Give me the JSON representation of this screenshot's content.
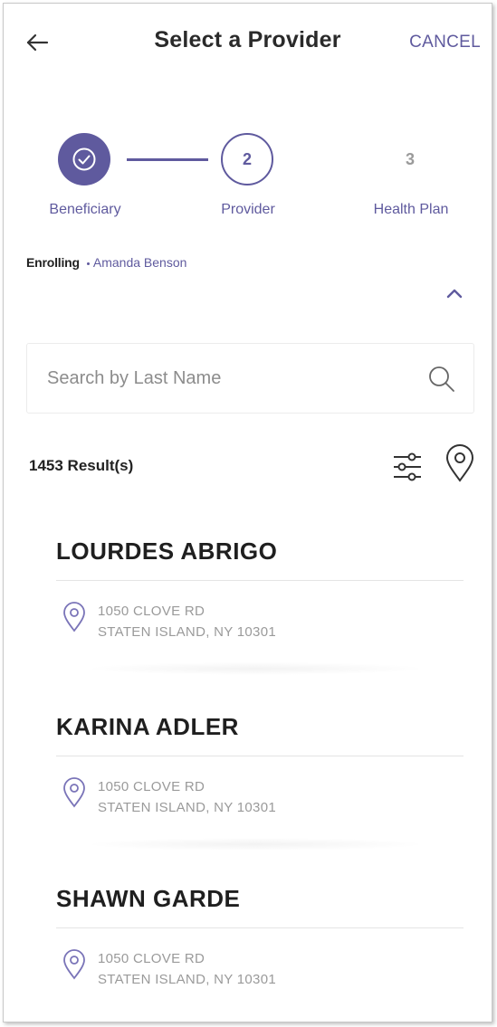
{
  "header": {
    "title": "Select a Provider",
    "cancel_label": "CANCEL"
  },
  "stepper": {
    "steps": [
      {
        "number": "1",
        "label": "Beneficiary",
        "state": "complete"
      },
      {
        "number": "2",
        "label": "Provider",
        "state": "current"
      },
      {
        "number": "3",
        "label": "Health Plan",
        "state": "upcoming"
      }
    ]
  },
  "enrolling": {
    "label": "Enrolling",
    "name": "Amanda Benson"
  },
  "search": {
    "placeholder": "Search by Last Name",
    "value": ""
  },
  "results": {
    "count_label": "1453 Result(s)"
  },
  "providers": [
    {
      "name": "LOURDES ABRIGO",
      "address_line1": "1050 CLOVE RD",
      "address_line2": "STATEN ISLAND, NY 10301"
    },
    {
      "name": "KARINA ADLER",
      "address_line1": "1050 CLOVE RD",
      "address_line2": "STATEN ISLAND, NY 10301"
    },
    {
      "name": "SHAWN GARDE",
      "address_line1": "1050 CLOVE RD",
      "address_line2": "STATEN ISLAND, NY 10301"
    }
  ],
  "colors": {
    "accent": "#5f5a9e",
    "text_dark": "#1f1f1f",
    "text_muted": "#9a9a9a"
  }
}
